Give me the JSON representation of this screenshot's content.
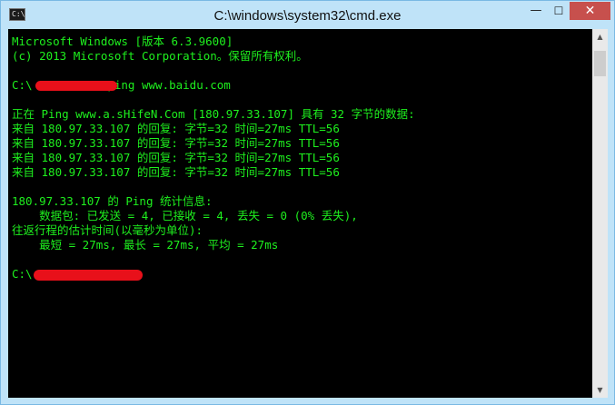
{
  "window": {
    "title": "C:\\windows\\system32\\cmd.exe",
    "icon_label": "C:\\",
    "minimize_glyph": "—",
    "maximize_glyph": "☐",
    "close_glyph": "✕"
  },
  "console": {
    "text_color": "#1ef01e",
    "lines": [
      "Microsoft Windows [版本 6.3.9600]",
      "(c) 2013 Microsoft Corporation。保留所有权利。",
      "",
      "C:\\          >ping www.baidu.com",
      "",
      "正在 Ping www.a.sHifeN.Com [180.97.33.107] 具有 32 字节的数据:",
      "来自 180.97.33.107 的回复: 字节=32 时间=27ms TTL=56",
      "来自 180.97.33.107 的回复: 字节=32 时间=27ms TTL=56",
      "来自 180.97.33.107 的回复: 字节=32 时间=27ms TTL=56",
      "来自 180.97.33.107 的回复: 字节=32 时间=27ms TTL=56",
      "",
      "180.97.33.107 的 Ping 统计信息:",
      "    数据包: 已发送 = 4, 已接收 = 4, 丢失 = 0 (0% 丢失),",
      "往返行程的估计时间(以毫秒为单位):",
      "    最短 = 27ms, 最长 = 27ms, 平均 = 27ms",
      "",
      "C:\\"
    ]
  },
  "scrollbar": {
    "up_glyph": "▲",
    "down_glyph": "▼"
  }
}
